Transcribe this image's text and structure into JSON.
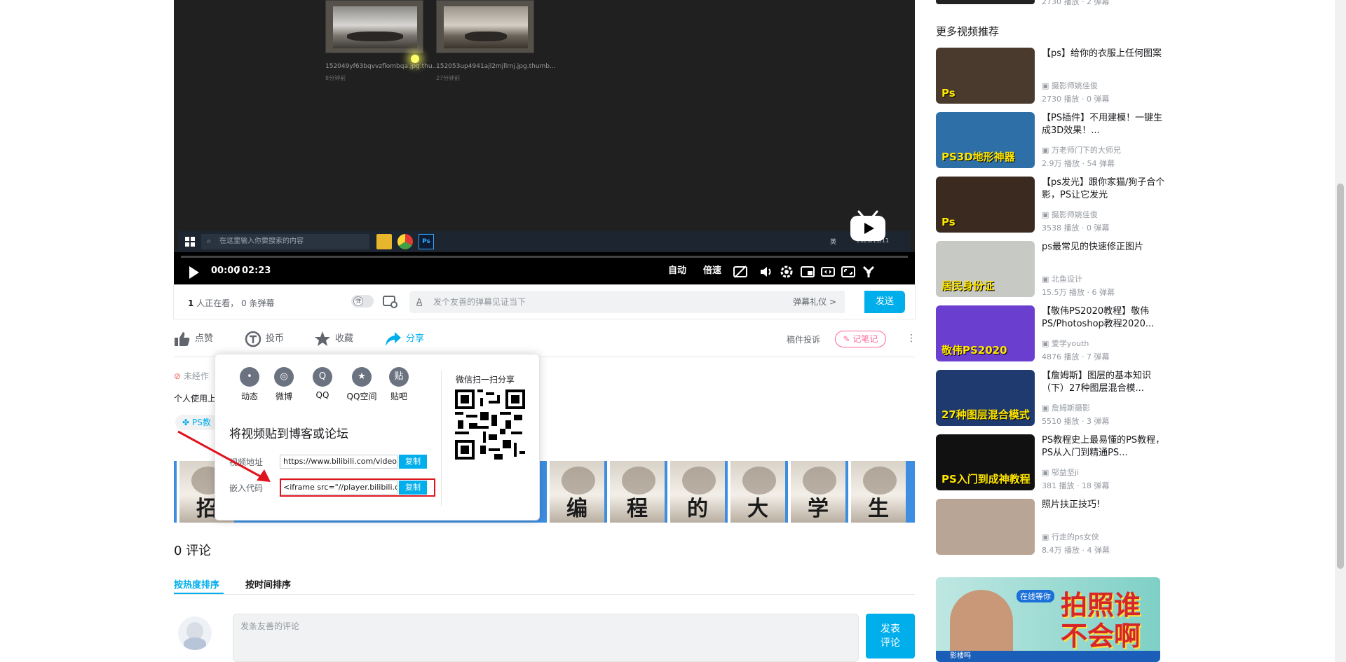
{
  "player": {
    "files": [
      {
        "name": "152049yf63bqvvzflombqa.jpg.thu...",
        "time": "8分钟前"
      },
      {
        "name": "152053up4941ajl2mjllrnj.jpg.thumb...",
        "time": "27分钟前"
      }
    ],
    "taskbar_search": "在这里输入你要搜索的内容",
    "taskbar_tray": "英",
    "taskbar_date": "2020/11/11",
    "current_time": "00:00",
    "time_sep": "/",
    "duration": "02:23",
    "progress": 0,
    "controls": {
      "auto": "自动",
      "speed": "倍速"
    }
  },
  "danmaku": {
    "viewer_count": "1",
    "viewer_text": "人正在看，",
    "danmaku_count": "0 条弹幕",
    "toggle_label": "弹",
    "placeholder": "发个友善的弹幕见证当下",
    "etiquette": "弹幕礼仪 >",
    "send": "发送"
  },
  "actions": {
    "like": "点赞",
    "coin": "投币",
    "favorite": "收藏",
    "share": "分享",
    "report": "稿件投诉",
    "notes": "记笔记"
  },
  "desc": {
    "origin": "未经作",
    "personal": "个人使用上",
    "tag": "PS教",
    "banner_chars": [
      "招",
      "编",
      "程",
      "的",
      "大",
      "学",
      "生"
    ]
  },
  "share_popup": {
    "items": [
      {
        "label": "动态",
        "glyph": "•"
      },
      {
        "label": "微博",
        "glyph": "◎"
      },
      {
        "label": "QQ",
        "glyph": "Q"
      },
      {
        "label": "QQ空间",
        "glyph": "★"
      },
      {
        "label": "贴吧",
        "glyph": "贴"
      }
    ],
    "heading": "将视频贴到博客或论坛",
    "url_label": "视频地址",
    "url_value": "https://www.bilibili.com/video/B",
    "embed_label": "嵌入代码",
    "embed_value": "<iframe src=\"//player.bilibili.co",
    "copy": "复制",
    "qr_title": "微信扫一扫分享"
  },
  "comments": {
    "count": "0",
    "title": "评论",
    "sort_hot": "按热度排序",
    "sort_time": "按时间排序",
    "placeholder": "发条友善的评论",
    "send_line1": "发表",
    "send_line2": "评论"
  },
  "sidebar": {
    "top_meta": "2730 播放 · 2 弹幕",
    "heading": "更多视频推荐",
    "items": [
      {
        "title": "【ps】给你的衣服上任何图案",
        "up": "摄影师姚佳俊",
        "stats": "2730 播放 · 0 弹幕",
        "thumb_text": "Ps",
        "color": "#4a3a2e"
      },
      {
        "title": "【PS插件】不用建模！一键生成3D效果！...",
        "up": "万老师门下的大师兄",
        "stats": "2.9万 播放 · 54 弹幕",
        "thumb_text": "PS3D地形神器",
        "color": "#2f6fa7"
      },
      {
        "title": "【ps发光】跟你家猫/狗子合个影，PS让它发光",
        "up": "摄影师姚佳俊",
        "stats": "3538 播放 · 0 弹幕",
        "thumb_text": "Ps",
        "color": "#3a2a20"
      },
      {
        "title": "ps最常见的快速修正图片",
        "up": "北鱼设计",
        "stats": "15.5万 播放 · 6 弹幕",
        "thumb_text": "居民身份证",
        "color": "#c7c9c4"
      },
      {
        "title": "【敬伟PS2020教程】敬伟PS/Photoshop教程2020...",
        "up": "爱学youth",
        "stats": "4876 播放 · 7 弹幕",
        "thumb_text": "敬伟PS2020",
        "color": "#6a3fd0"
      },
      {
        "title": "【詹姆斯】图层的基本知识（下）27种图层混合模...",
        "up": "詹姆斯摄影",
        "stats": "5510 播放 · 3 弹幕",
        "thumb_text": "27种图层混合模式",
        "color": "#1f3a6e"
      },
      {
        "title": "PS教程史上最易懂的PS教程，PS从入门到精通PS...",
        "up": "邬益坚ji",
        "stats": "381 播放 · 18 弹幕",
        "thumb_text": "PS入门到成神教程",
        "color": "#111111"
      },
      {
        "title": "照片扶正技巧!",
        "up": "行走的ps女侠",
        "stats": "8.4万 播放 · 4 弹幕",
        "thumb_text": "",
        "color": "#b9a595"
      }
    ],
    "ad": {
      "title": "拍照谁不会啊",
      "sub": "在线等你",
      "caption": "影楼吗"
    }
  }
}
